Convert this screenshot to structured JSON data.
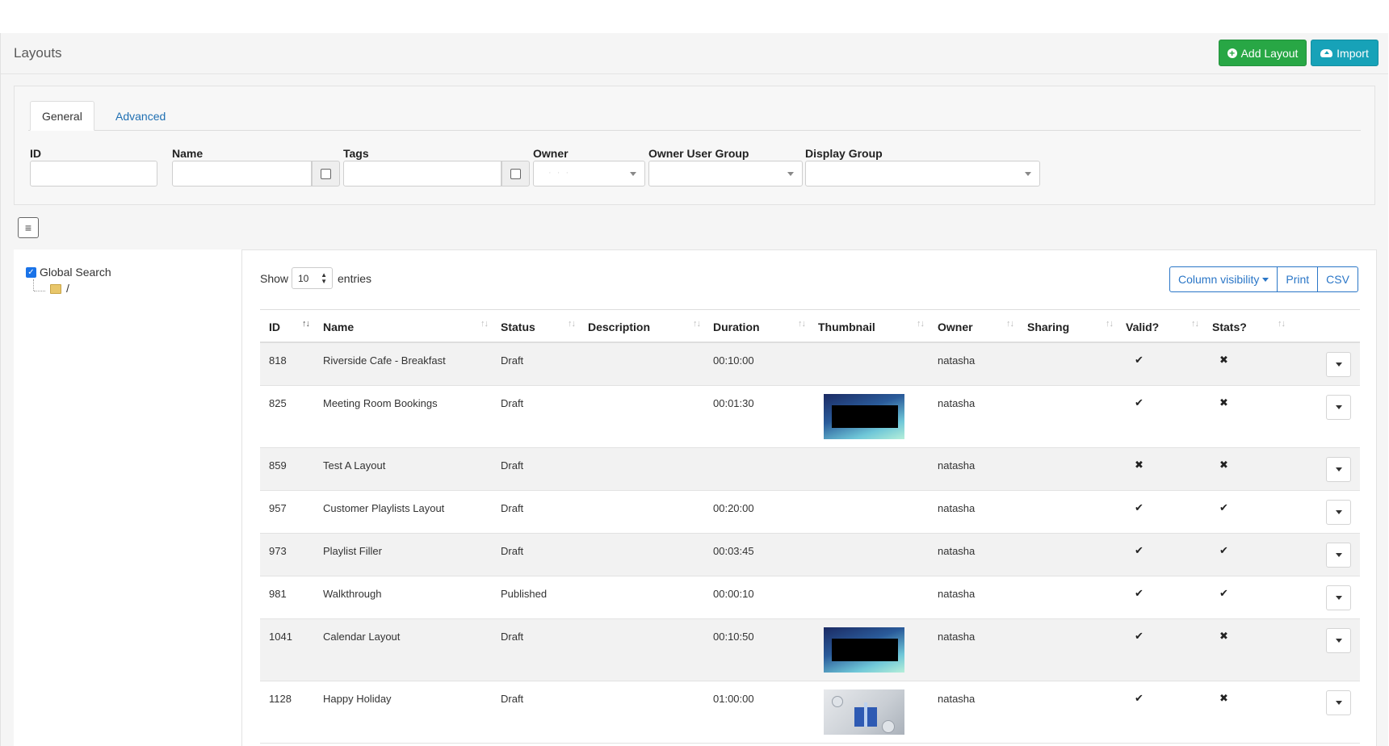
{
  "page_title": "Layouts",
  "header_buttons": {
    "add_layout": "Add Layout",
    "import": "Import"
  },
  "filter_tabs": [
    "General",
    "Advanced"
  ],
  "filters": {
    "id_label": "ID",
    "name_label": "Name",
    "tags_label": "Tags",
    "owner_label": "Owner",
    "owner_user_group_label": "Owner User Group",
    "display_group_label": "Display Group"
  },
  "sidebar": {
    "global_search_label": "Global Search",
    "root_folder": "/"
  },
  "table_controls": {
    "show_label": "Show",
    "page_length": "10",
    "entries_label": "entries",
    "column_visibility": "Column visibility",
    "print": "Print",
    "csv": "CSV"
  },
  "columns": [
    "ID",
    "Name",
    "Status",
    "Description",
    "Duration",
    "Thumbnail",
    "Owner",
    "Sharing",
    "Valid?",
    "Stats?"
  ],
  "rows": [
    {
      "id": "818",
      "name": "Riverside Cafe - Breakfast",
      "status": "Draft",
      "description": "",
      "duration": "00:10:00",
      "thumbnail": "none",
      "owner": "natasha",
      "sharing": "",
      "valid": "✔",
      "stats": "✖"
    },
    {
      "id": "825",
      "name": "Meeting Room Bookings",
      "status": "Draft",
      "description": "",
      "duration": "00:01:30",
      "thumbnail": "blue",
      "owner": "natasha",
      "sharing": "",
      "valid": "✔",
      "stats": "✖"
    },
    {
      "id": "859",
      "name": "Test A Layout",
      "status": "Draft",
      "description": "",
      "duration": "",
      "thumbnail": "none",
      "owner": "natasha",
      "sharing": "",
      "valid": "✖",
      "stats": "✖"
    },
    {
      "id": "957",
      "name": "Customer Playlists Layout",
      "status": "Draft",
      "description": "",
      "duration": "00:20:00",
      "thumbnail": "none",
      "owner": "natasha",
      "sharing": "",
      "valid": "✔",
      "stats": "✔"
    },
    {
      "id": "973",
      "name": "Playlist Filler",
      "status": "Draft",
      "description": "",
      "duration": "00:03:45",
      "thumbnail": "none",
      "owner": "natasha",
      "sharing": "",
      "valid": "✔",
      "stats": "✔"
    },
    {
      "id": "981",
      "name": "Walkthrough",
      "status": "Published",
      "description": "",
      "duration": "00:00:10",
      "thumbnail": "none",
      "owner": "natasha",
      "sharing": "",
      "valid": "✔",
      "stats": "✔"
    },
    {
      "id": "1041",
      "name": "Calendar Layout",
      "status": "Draft",
      "description": "",
      "duration": "00:10:50",
      "thumbnail": "blue",
      "owner": "natasha",
      "sharing": "",
      "valid": "✔",
      "stats": "✖"
    },
    {
      "id": "1128",
      "name": "Happy Holiday",
      "status": "Draft",
      "description": "",
      "duration": "01:00:00",
      "thumbnail": "gift",
      "owner": "natasha",
      "sharing": "",
      "valid": "✔",
      "stats": "✖"
    }
  ]
}
